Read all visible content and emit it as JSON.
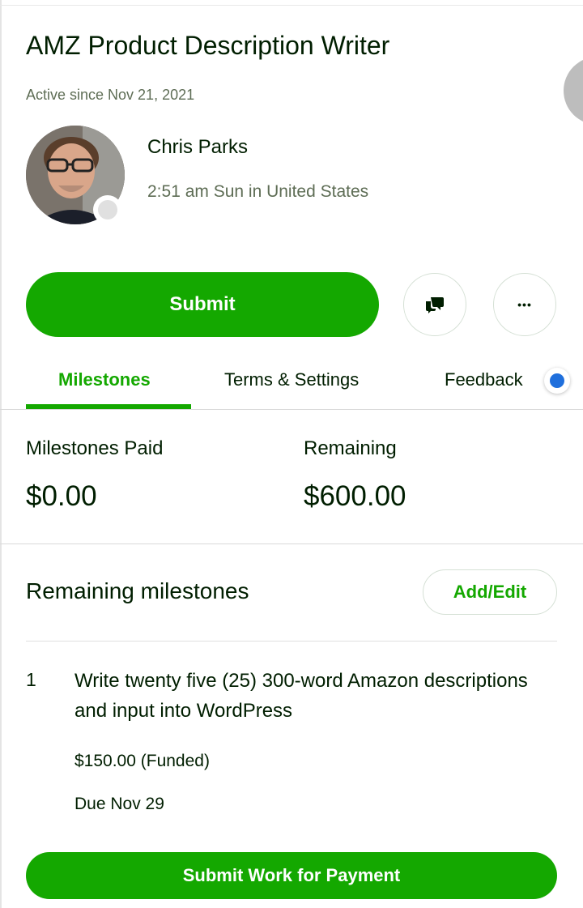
{
  "header": {
    "title": "AMZ Product Description Writer",
    "active_since": "Active since Nov 21, 2021"
  },
  "freelancer": {
    "name": "Chris Parks",
    "local_time": "2:51 am Sun in United States",
    "status": "offline"
  },
  "actions": {
    "submit_label": "Submit",
    "message_icon": "message-icon",
    "more_icon": "more-options-icon",
    "more_glyph": "•••"
  },
  "tabs": [
    {
      "label": "Milestones",
      "active": true
    },
    {
      "label": "Terms & Settings",
      "active": false
    },
    {
      "label": "Feedback",
      "active": false,
      "has_notification": true
    }
  ],
  "summary": {
    "paid_label": "Milestones Paid",
    "paid_value": "$0.00",
    "remaining_label": "Remaining",
    "remaining_value": "$600.00"
  },
  "remaining_milestones": {
    "title": "Remaining milestones",
    "add_edit_label": "Add/Edit",
    "items": [
      {
        "number": "1",
        "description": "Write twenty five (25) 300-word Amazon descriptions and input into WordPress",
        "amount": "$150.00 (Funded)",
        "due": "Due Nov 29",
        "submit_label": "Submit Work for Payment"
      }
    ]
  },
  "colors": {
    "accent": "#14a800",
    "notification": "#1f6fdc",
    "text": "#001e00",
    "muted": "#5e6d55"
  }
}
